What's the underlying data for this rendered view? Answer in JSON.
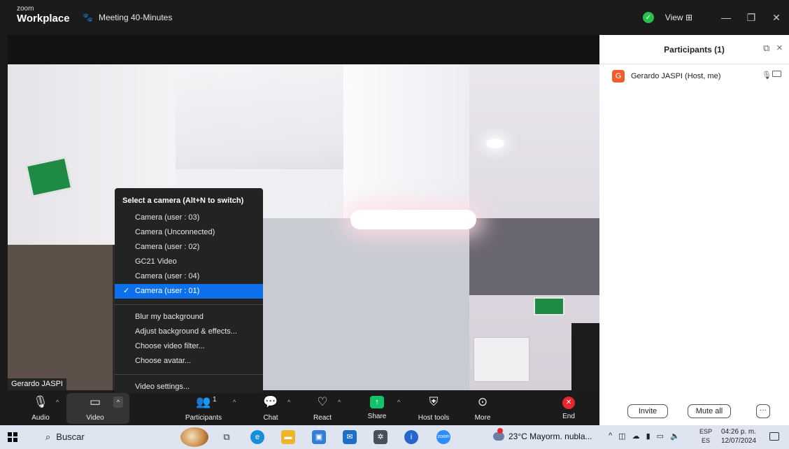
{
  "window": {
    "logo_top": "zoom",
    "logo_bottom": "Workplace",
    "meeting_title": "Meeting 40-Minutes",
    "view_label": "View",
    "controls": [
      "—",
      "❐",
      "✕"
    ]
  },
  "video": {
    "participant_name": "Gerardo JASPI"
  },
  "participants_panel": {
    "title": "Participants (1)",
    "participants": [
      {
        "initial": "G",
        "name": "Gerardo JASPI (Host, me)",
        "avatar_color": "#f25c2c"
      }
    ],
    "invite_label": "Invite",
    "mute_all_label": "Mute all",
    "more_label": "···"
  },
  "toolbar": {
    "audio": "Audio",
    "video": "Video",
    "participants": "Participants",
    "participants_count": "1",
    "chat": "Chat",
    "react": "React",
    "share": "Share",
    "host_tools": "Host tools",
    "more": "More",
    "end": "End"
  },
  "camera_menu": {
    "header": "Select a camera (Alt+N to switch)",
    "cameras": [
      {
        "label": "Camera (user : 03)",
        "selected": false
      },
      {
        "label": "Camera (Unconnected)",
        "selected": false
      },
      {
        "label": "Camera (user : 02)",
        "selected": false
      },
      {
        "label": "GC21 Video",
        "selected": false
      },
      {
        "label": "Camera (user : 04)",
        "selected": false
      },
      {
        "label": "Camera (user : 01)",
        "selected": true
      }
    ],
    "options": [
      "Blur my background",
      "Adjust background & effects...",
      "Choose video filter...",
      "Choose avatar..."
    ],
    "settings": "Video settings...",
    "accent_color": "#0e71eb"
  },
  "taskbar": {
    "search_label": "Buscar",
    "weather": "23°C  Mayorm. nubla...",
    "lang_top": "ESP",
    "lang_bottom": "ES",
    "time": "04:26 p. m.",
    "date": "12/07/2024"
  }
}
